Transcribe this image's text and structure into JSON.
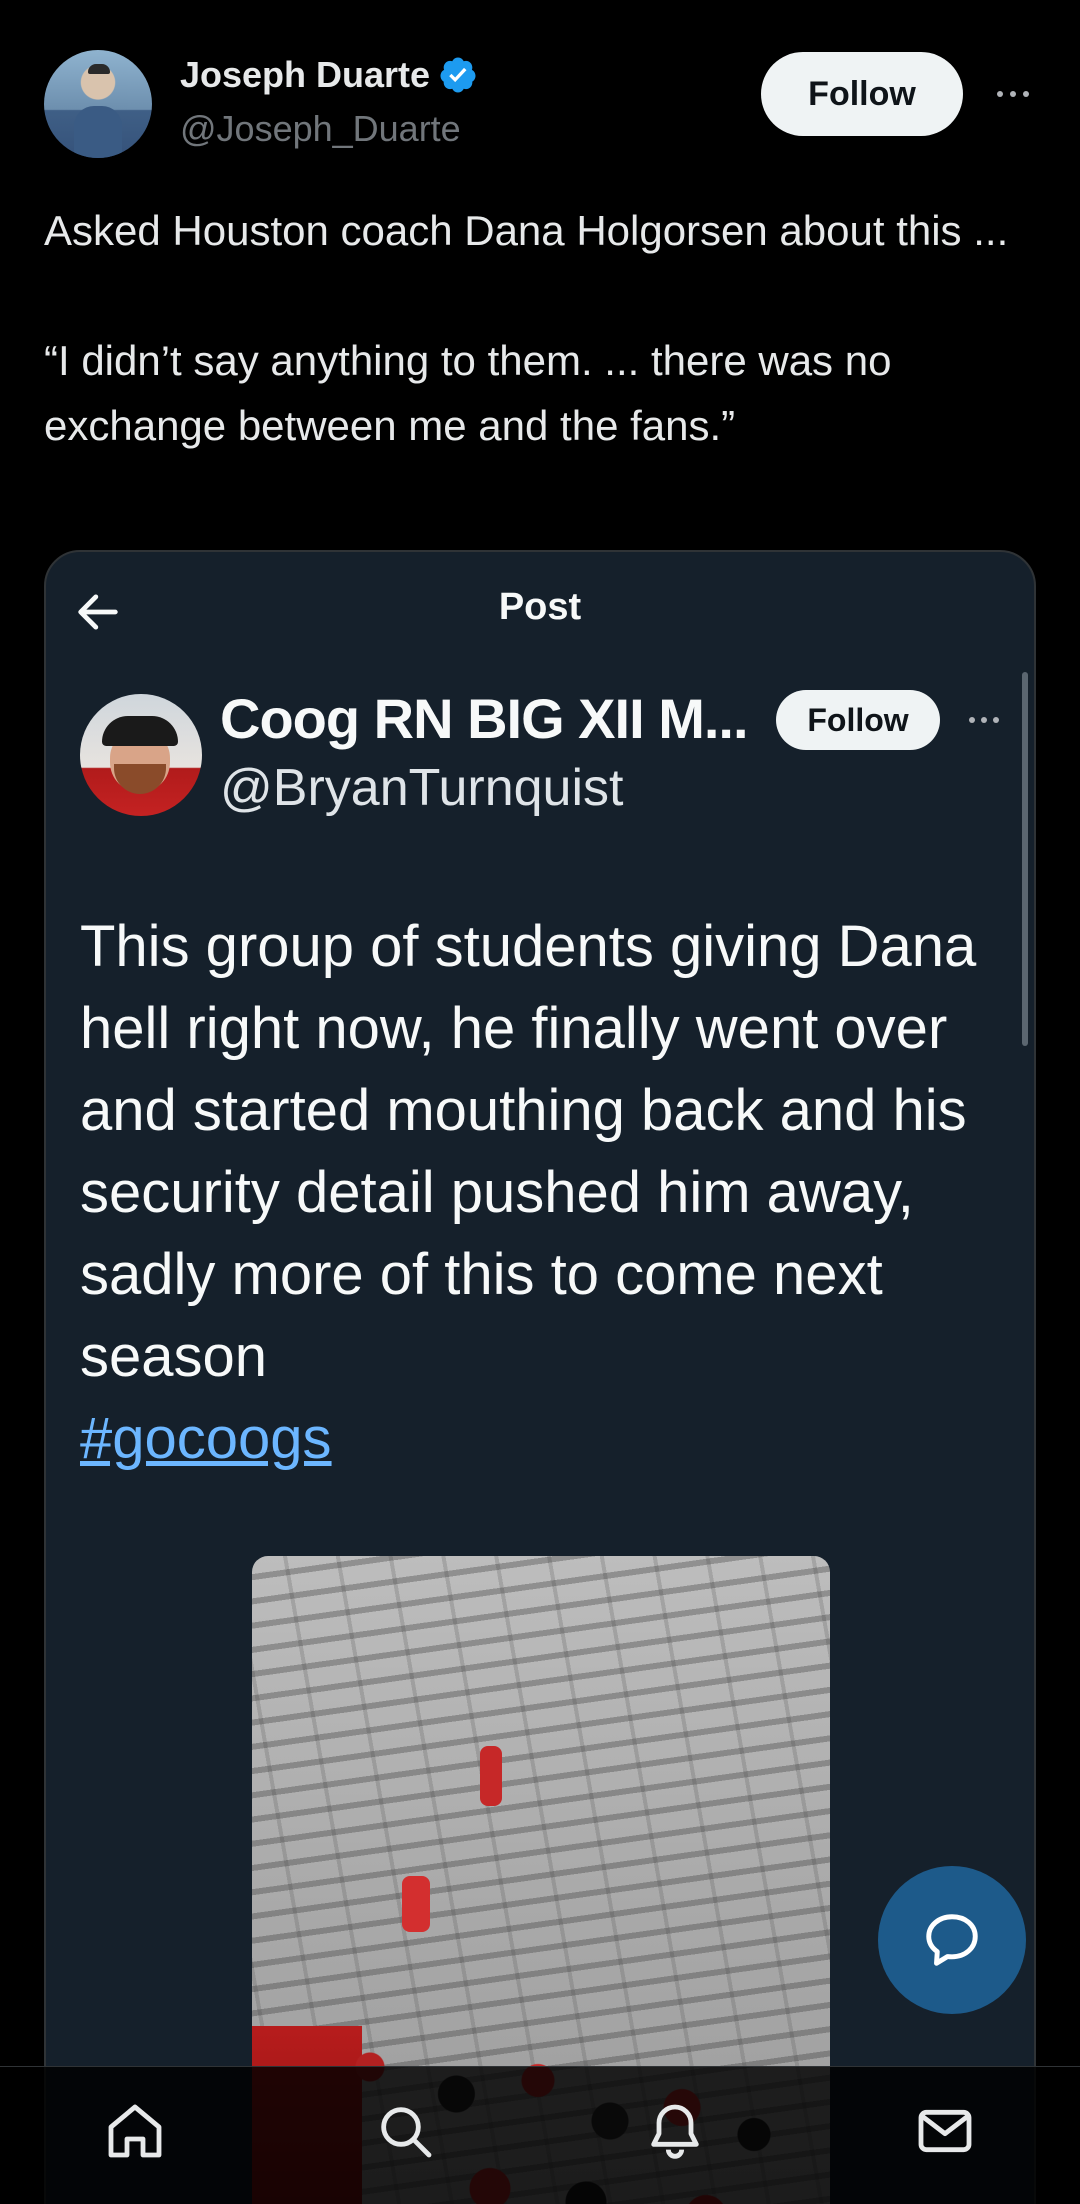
{
  "tweet": {
    "author_name": "Joseph Duarte",
    "author_handle": "@Joseph_Duarte",
    "follow_label": "Follow",
    "text_line1": "Asked Houston coach Dana Holgorsen about this ...",
    "text_line2": "“I didn’t say anything to them.  ... there was no exchange between me and the fans.”"
  },
  "embedded": {
    "title": "Post",
    "author_name": "Coog RN BIG XII M...",
    "author_handle": "@BryanTurnquist",
    "follow_label": "Follow",
    "text": "This group of students giving Dana hell right now, he finally went over and started mouthing back and his security detail pushed him away, sadly more of this to come next season ",
    "hashtag": "#gocoogs"
  },
  "nav": {
    "items": [
      "home-icon",
      "search-icon",
      "notifications-icon",
      "messages-icon"
    ]
  },
  "colors": {
    "background": "#000000",
    "card_background": "#15202b",
    "verified": "#1d9bf0",
    "hashtag": "#6cb6ff",
    "fab": "#1d5a8a"
  }
}
